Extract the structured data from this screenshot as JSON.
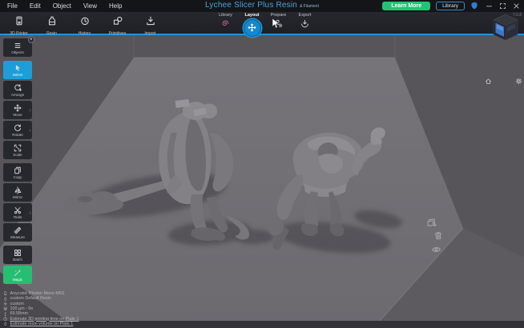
{
  "window": {
    "title": "Lychee Slicer Plus Resin",
    "title_suffix": "& Filament",
    "version": "7.6.8"
  },
  "menu_bar": {
    "items": [
      "File",
      "Edit",
      "Object",
      "View",
      "Help"
    ]
  },
  "header": {
    "learn_more_label": "Learn More",
    "library_label": "Library"
  },
  "toolbar": {
    "items": [
      {
        "id": "printer3d",
        "label": "3D Printer"
      },
      {
        "id": "resin",
        "label": "Resin"
      },
      {
        "id": "history",
        "label": "History"
      },
      {
        "id": "primitives",
        "label": "Primitives"
      },
      {
        "id": "import",
        "label": "Import"
      }
    ]
  },
  "mode_tabs": {
    "items": [
      {
        "id": "library",
        "label": "Library",
        "active": false
      },
      {
        "id": "layout",
        "label": "Layout",
        "active": true
      },
      {
        "id": "prepare",
        "label": "Prepare",
        "active": false
      },
      {
        "id": "export",
        "label": "Export",
        "active": false
      }
    ]
  },
  "sidebar": {
    "groups": [
      [
        {
          "id": "objects",
          "label": "Objects",
          "badge": "9"
        }
      ],
      [
        {
          "id": "select",
          "label": "Select",
          "state": "active-blue"
        },
        {
          "id": "arrange",
          "label": "Arrange"
        },
        {
          "id": "move",
          "label": "Move",
          "submenu": true
        },
        {
          "id": "rotate",
          "label": "Rotate",
          "submenu": true
        },
        {
          "id": "scale",
          "label": "Scale"
        }
      ],
      [
        {
          "id": "copy",
          "label": "Copy"
        },
        {
          "id": "mirror",
          "label": "Mirror"
        },
        {
          "id": "tools",
          "label": "Tools",
          "submenu": true
        },
        {
          "id": "measure",
          "label": "Measure"
        }
      ],
      [
        {
          "id": "batch",
          "label": "Batch"
        },
        {
          "id": "magic",
          "label": "Magic",
          "state": "active-green"
        }
      ]
    ]
  },
  "plate_tools": [
    {
      "id": "duplicate-plate"
    },
    {
      "id": "delete-plate"
    },
    {
      "id": "toggle-visibility"
    }
  ],
  "status_panel": {
    "lines": [
      {
        "icon": "printer",
        "text": "Anycubic Photon Mono M5S",
        "link": false
      },
      {
        "icon": "resin-drop",
        "text": "custom Default Resin",
        "link": false
      },
      {
        "icon": "profile",
        "text": "custom",
        "link": false
      },
      {
        "icon": "layers",
        "text": "100 μm - 0s",
        "link": false
      },
      {
        "icon": "height",
        "text": "69.58mm",
        "link": false
      },
      {
        "icon": "clock",
        "text": "Estimate 3D printing time on Plate 1",
        "link": true
      },
      {
        "icon": "resin-drop",
        "text": "Estimate resin volume on Plate 1",
        "link": true
      }
    ]
  },
  "viewport": {
    "models": [
      "winged-demon-miniature",
      "ogre-miniature"
    ]
  },
  "colors": {
    "accent_blue": "#1b96d6",
    "select_blue": "#1d9ed9",
    "magic_green": "#26bf71",
    "learn_more_green": "#1fc573",
    "title_blue": "#4aa4d8",
    "viewport_bg": "#57555a",
    "build_plate": "#727075"
  }
}
